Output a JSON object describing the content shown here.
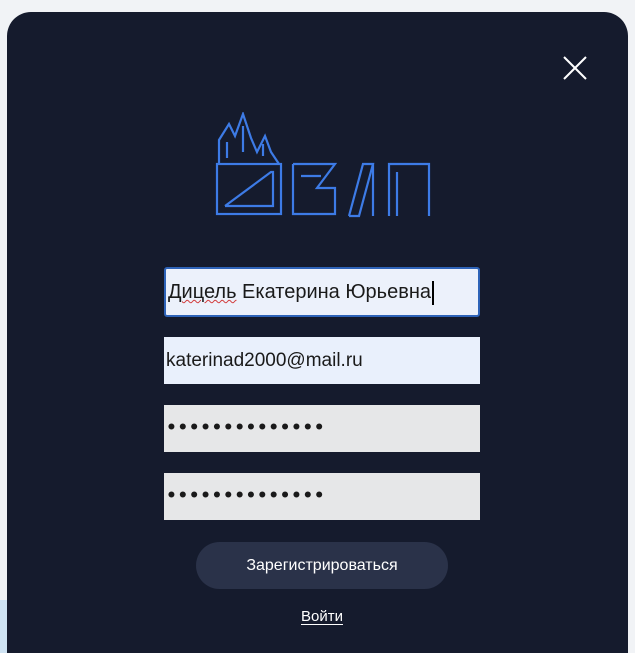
{
  "form": {
    "full_name": "Дицель Екатерина Юрьевна",
    "full_name_first_word": "Дицель",
    "full_name_rest": " Екатерина Юрьевна",
    "email": "katerinad2000@mail.ru",
    "password_mask": "••••••••••••••",
    "password_confirm_mask": "••••••••••••••"
  },
  "buttons": {
    "register_label": "Зарегистрироваться",
    "login_label": "Войти"
  },
  "icons": {
    "close": "close-icon",
    "logo": "logo-icon"
  },
  "colors": {
    "modal_bg": "#151b2d",
    "logo_stroke": "#3d7be6",
    "button_bg": "#2a3249",
    "focus_border": "#2e63b8"
  }
}
